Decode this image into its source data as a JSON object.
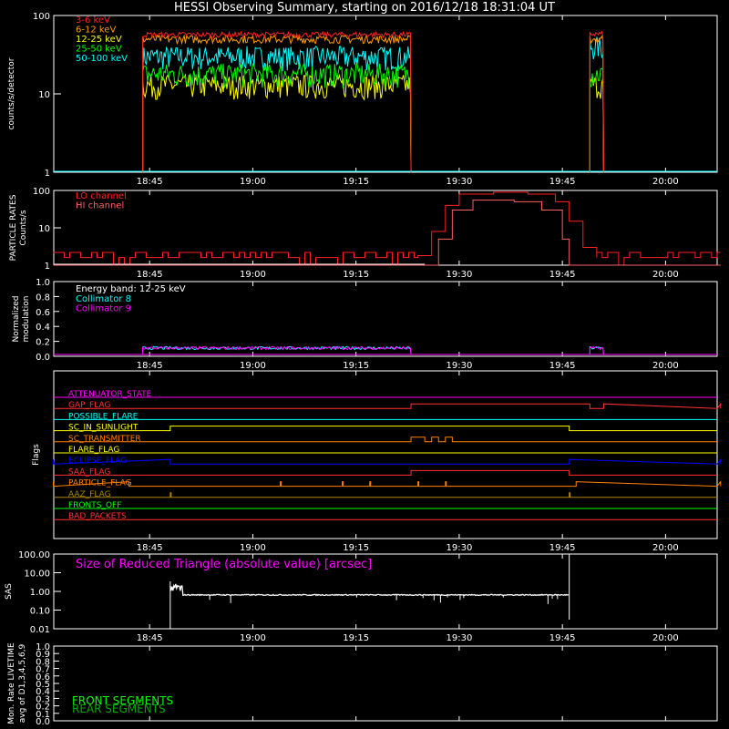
{
  "title": "HESSI Observing Summary, starting on 2016/12/18 18:31:04 UT",
  "colors": {
    "background": "#000000",
    "axis": "#ffffff",
    "band_3_6": "#ff2020",
    "band_6_12": "#ff9a00",
    "band_12_25": "#ffff00",
    "band_25_50": "#00ff00",
    "band_50_100": "#00ffff",
    "lo_channel": "#ff2020",
    "hi_channel": "#ff6060",
    "collimator_8": "#00ffff",
    "collimator_9": "#ff00ff",
    "sas": "#ffffff",
    "front_segments": "#00ff00",
    "rear_segments": "#00aa00"
  },
  "time_axis": {
    "start": "18:31:04",
    "end": "20:07:30",
    "tick_labels": [
      "18:45",
      "19:00",
      "19:15",
      "19:30",
      "19:45",
      "20:00"
    ],
    "tick_minutes_from_18_30": [
      15,
      30,
      45,
      60,
      75,
      90
    ]
  },
  "chart_data": [
    {
      "type": "line",
      "panel": "counts",
      "ylabel": "counts/s/detector",
      "yscale": "log",
      "ylim": [
        1,
        100
      ],
      "ytick_labels": [
        "1",
        "10",
        "100"
      ],
      "series": [
        {
          "name": "3-6 keV",
          "segments": [
            {
              "start": "18:44",
              "end": "19:23",
              "level": 57
            },
            {
              "start": "19:49",
              "end": "19:51",
              "level": 58
            }
          ]
        },
        {
          "name": "6-12 keV",
          "segments": [
            {
              "start": "18:44",
              "end": "19:23",
              "level": 50
            },
            {
              "start": "19:49",
              "end": "19:51",
              "level": 50
            }
          ]
        },
        {
          "name": "12-25 keV",
          "segments": [
            {
              "start": "18:44",
              "end": "19:23",
              "level": 13
            },
            {
              "start": "19:49",
              "end": "19:51",
              "level": 13
            }
          ]
        },
        {
          "name": "25-50 keV",
          "segments": [
            {
              "start": "18:44",
              "end": "19:23",
              "level": 18
            },
            {
              "start": "19:49",
              "end": "19:51",
              "level": 18
            }
          ]
        },
        {
          "name": "50-100 keV",
          "segments": [
            {
              "start": "18:44",
              "end": "19:23",
              "level": 30
            },
            {
              "start": "19:49",
              "end": "19:51",
              "level": 40
            }
          ]
        }
      ]
    },
    {
      "type": "line",
      "panel": "particle_rates",
      "ylabel": "PARTICLE RATES Counts/s",
      "yscale": "log",
      "ylim": [
        1,
        100
      ],
      "ytick_labels": [
        "1",
        "10",
        "100"
      ],
      "series": [
        {
          "name": "LO channel",
          "x": [
            "18:31",
            "19:24",
            "19:26",
            "19:28",
            "19:30",
            "19:35",
            "19:40",
            "19:44",
            "19:46",
            "19:48",
            "19:50",
            "20:08"
          ],
          "values": [
            1.6,
            1.8,
            8,
            40,
            80,
            90,
            80,
            50,
            15,
            3,
            1.6,
            1.5
          ]
        },
        {
          "name": "HI channel",
          "x": [
            "18:31",
            "19:25",
            "19:27",
            "19:29",
            "19:32",
            "19:38",
            "19:42",
            "19:45",
            "19:46",
            "20:08"
          ],
          "values": [
            1,
            1,
            5,
            30,
            55,
            50,
            30,
            5,
            1,
            1
          ]
        }
      ]
    },
    {
      "type": "line",
      "panel": "modulation",
      "ylabel": "Normalized modulation",
      "ylim": [
        0,
        1
      ],
      "ytick_labels": [
        "0.0",
        "0.2",
        "0.4",
        "0.6",
        "0.8",
        "1.0"
      ],
      "annotation": "Energy band: 12-25 keV",
      "series": [
        {
          "name": "Collimator 8",
          "segments": [
            {
              "start": "18:44",
              "end": "19:23",
              "level": 0.11
            },
            {
              "start": "19:49",
              "end": "19:51",
              "level": 0.11
            }
          ]
        },
        {
          "name": "Collimator 9",
          "segments": [
            {
              "start": "18:44",
              "end": "19:23",
              "level": 0.11
            },
            {
              "start": "19:49",
              "end": "19:51",
              "level": 0.11
            }
          ]
        }
      ]
    },
    {
      "type": "line",
      "panel": "flags",
      "ylabel": "Flags",
      "series": [
        {
          "name": "ATTENUATOR_STATE",
          "color": "#ff00ff",
          "high": []
        },
        {
          "name": "GAP_FLAG",
          "color": "#ff3030",
          "high": [
            [
              "19:23",
              "19:49"
            ],
            [
              "19:51",
              "20:08"
            ]
          ]
        },
        {
          "name": "POSSIBLE_FLARE",
          "color": "#00ffff",
          "high": []
        },
        {
          "name": "SC_IN_SUNLIGHT",
          "color": "#ffff00",
          "high": [
            [
              "18:48",
              "19:46"
            ]
          ]
        },
        {
          "name": "SC_TRANSMITTER",
          "color": "#ff8000",
          "high": [
            [
              "19:23",
              "19:25"
            ],
            [
              "19:26",
              "19:27"
            ],
            [
              "19:28",
              "19:29"
            ]
          ]
        },
        {
          "name": "FLARE_FLAG",
          "color": "#ffff00",
          "high": []
        },
        {
          "name": "ECLIPSE_FLAG",
          "color": "#0000ff",
          "high": [
            [
              "18:31",
              "18:48"
            ],
            [
              "19:46",
              "20:08"
            ]
          ]
        },
        {
          "name": "SAA_FLAG",
          "color": "#ff3030",
          "high": [
            [
              "19:23",
              "19:46"
            ]
          ]
        },
        {
          "name": "PARTICLE_FLAG",
          "color": "#ff8000",
          "high": [
            [
              "18:31",
              "18:42"
            ],
            [
              "19:47",
              "20:08"
            ]
          ]
        },
        {
          "name": "AAZ_FLAG",
          "color": "#aa8800",
          "high": [
            [
              "18:48",
              "18:48"
            ],
            [
              "19:46",
              "19:46"
            ]
          ]
        },
        {
          "name": "FRONTS_OFF",
          "color": "#00ff00",
          "high": []
        },
        {
          "name": "BAD_PACKETS",
          "color": "#ff3030",
          "high": []
        }
      ]
    },
    {
      "type": "line",
      "panel": "sas",
      "ylabel": "SAS",
      "yscale": "log",
      "ylim": [
        0.01,
        100
      ],
      "ytick_labels": [
        "0.01",
        "0.10",
        "1.00",
        "10.00",
        "100.00"
      ],
      "annotation": "Size of Reduced Triangle (absolute value) [arcsec]",
      "series": [
        {
          "name": "SAS triangle",
          "x": [
            "18:48",
            "18:49",
            "18:52",
            "19:00",
            "19:15",
            "19:30",
            "19:45",
            "19:46"
          ],
          "values": [
            0.5,
            0.8,
            0.7,
            0.65,
            0.65,
            0.68,
            0.7,
            0.8
          ]
        }
      ]
    },
    {
      "type": "line",
      "panel": "livetime",
      "ylabel": "Mon. Rate LIVETIME avg of D1,3,4,5,6,9",
      "ylim": [
        0,
        1
      ],
      "ytick_labels": [
        "0.0",
        "0.1",
        "0.2",
        "0.3",
        "0.4",
        "0.5",
        "0.6",
        "0.7",
        "0.8",
        "0.9",
        "1.0"
      ],
      "series": [
        {
          "name": "FRONT SEGMENTS",
          "values": []
        },
        {
          "name": "REAR SEGMENTS",
          "values": []
        }
      ]
    }
  ]
}
